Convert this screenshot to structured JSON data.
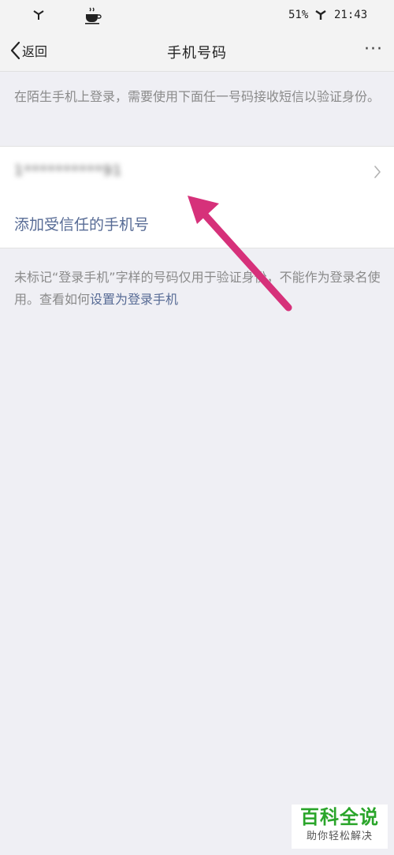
{
  "status_bar": {
    "battery": "51%",
    "time": "21:43",
    "icons": [
      "signal-icon",
      "coffee-icon",
      "signal-icon"
    ]
  },
  "nav": {
    "back_label": "返回",
    "title": "手机号码",
    "more_label": "···"
  },
  "description": "在陌生手机上登录，需要使用下面任一号码接收短信以验证身份。",
  "phone_row": {
    "number": "1**********91"
  },
  "add_trusted": "添加受信任的手机号",
  "note": {
    "text": "未标记“登录手机”字样的号码仅用于验证身份，不能作为登录名使用。查看如何",
    "link": "设置为登录手机"
  },
  "watermark": {
    "title": "百科全说",
    "subtitle": "助你轻松解决"
  },
  "colors": {
    "background": "#efeff4",
    "link": "#576b95",
    "annotation_arrow": "#d6317a",
    "watermark_green": "#2aa52a"
  }
}
